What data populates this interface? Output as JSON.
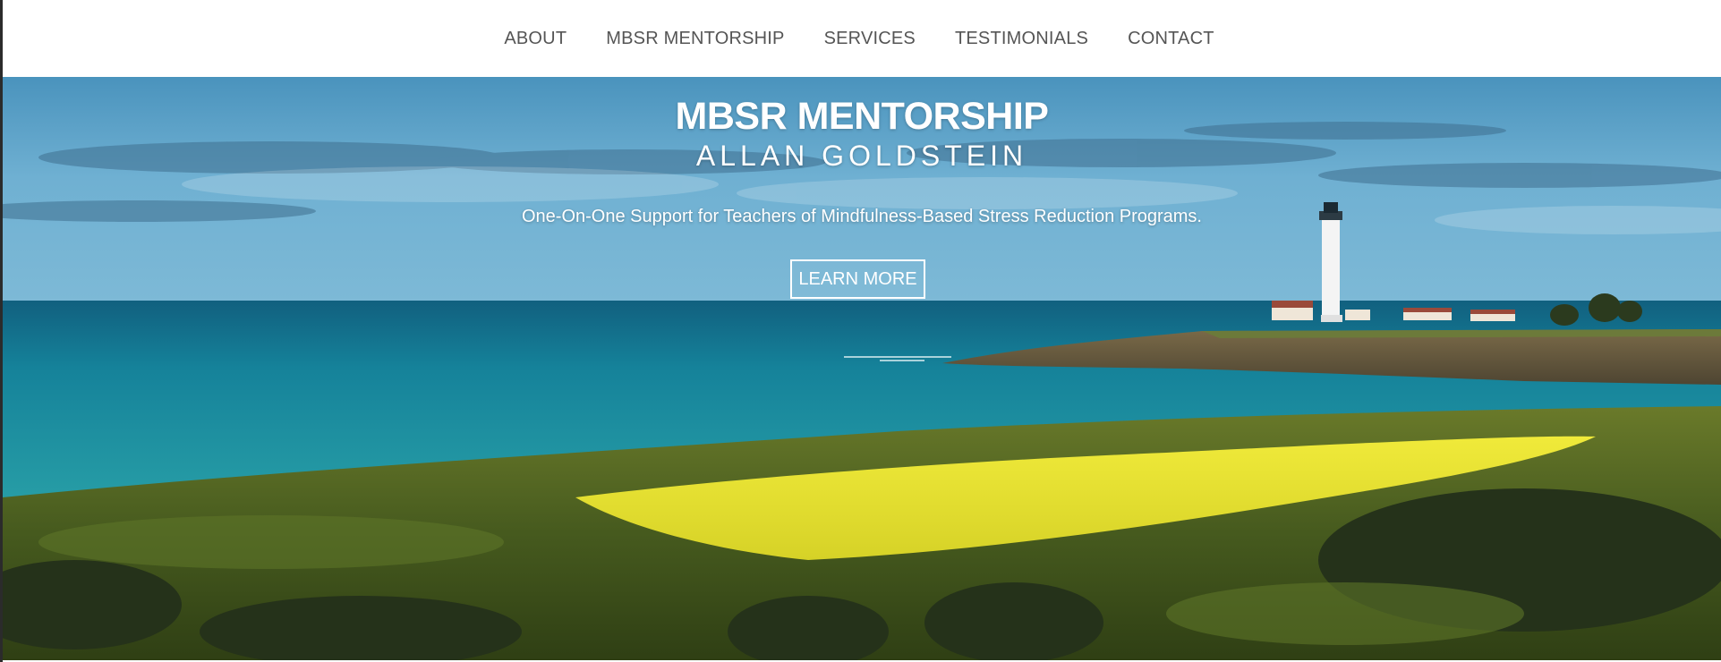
{
  "nav": {
    "items": [
      "ABOUT",
      "MBSR MENTORSHIP",
      "SERVICES",
      "TESTIMONIALS",
      "CONTACT"
    ]
  },
  "hero": {
    "title": "MBSR MENTORSHIP",
    "subtitle": "ALLAN GOLDSTEIN",
    "tagline": "One-On-One Support for Teachers of Mindfulness-Based Stress Reduction Programs.",
    "cta_label": "LEARN MORE",
    "image": "coastal-lighthouse-landscape"
  },
  "colors": {
    "nav_text": "#555555",
    "sky": "#5ba3c9",
    "ocean": "#1d8a9e",
    "meadow_flowers": "#e8e22c",
    "grass": "#4e5f22"
  }
}
